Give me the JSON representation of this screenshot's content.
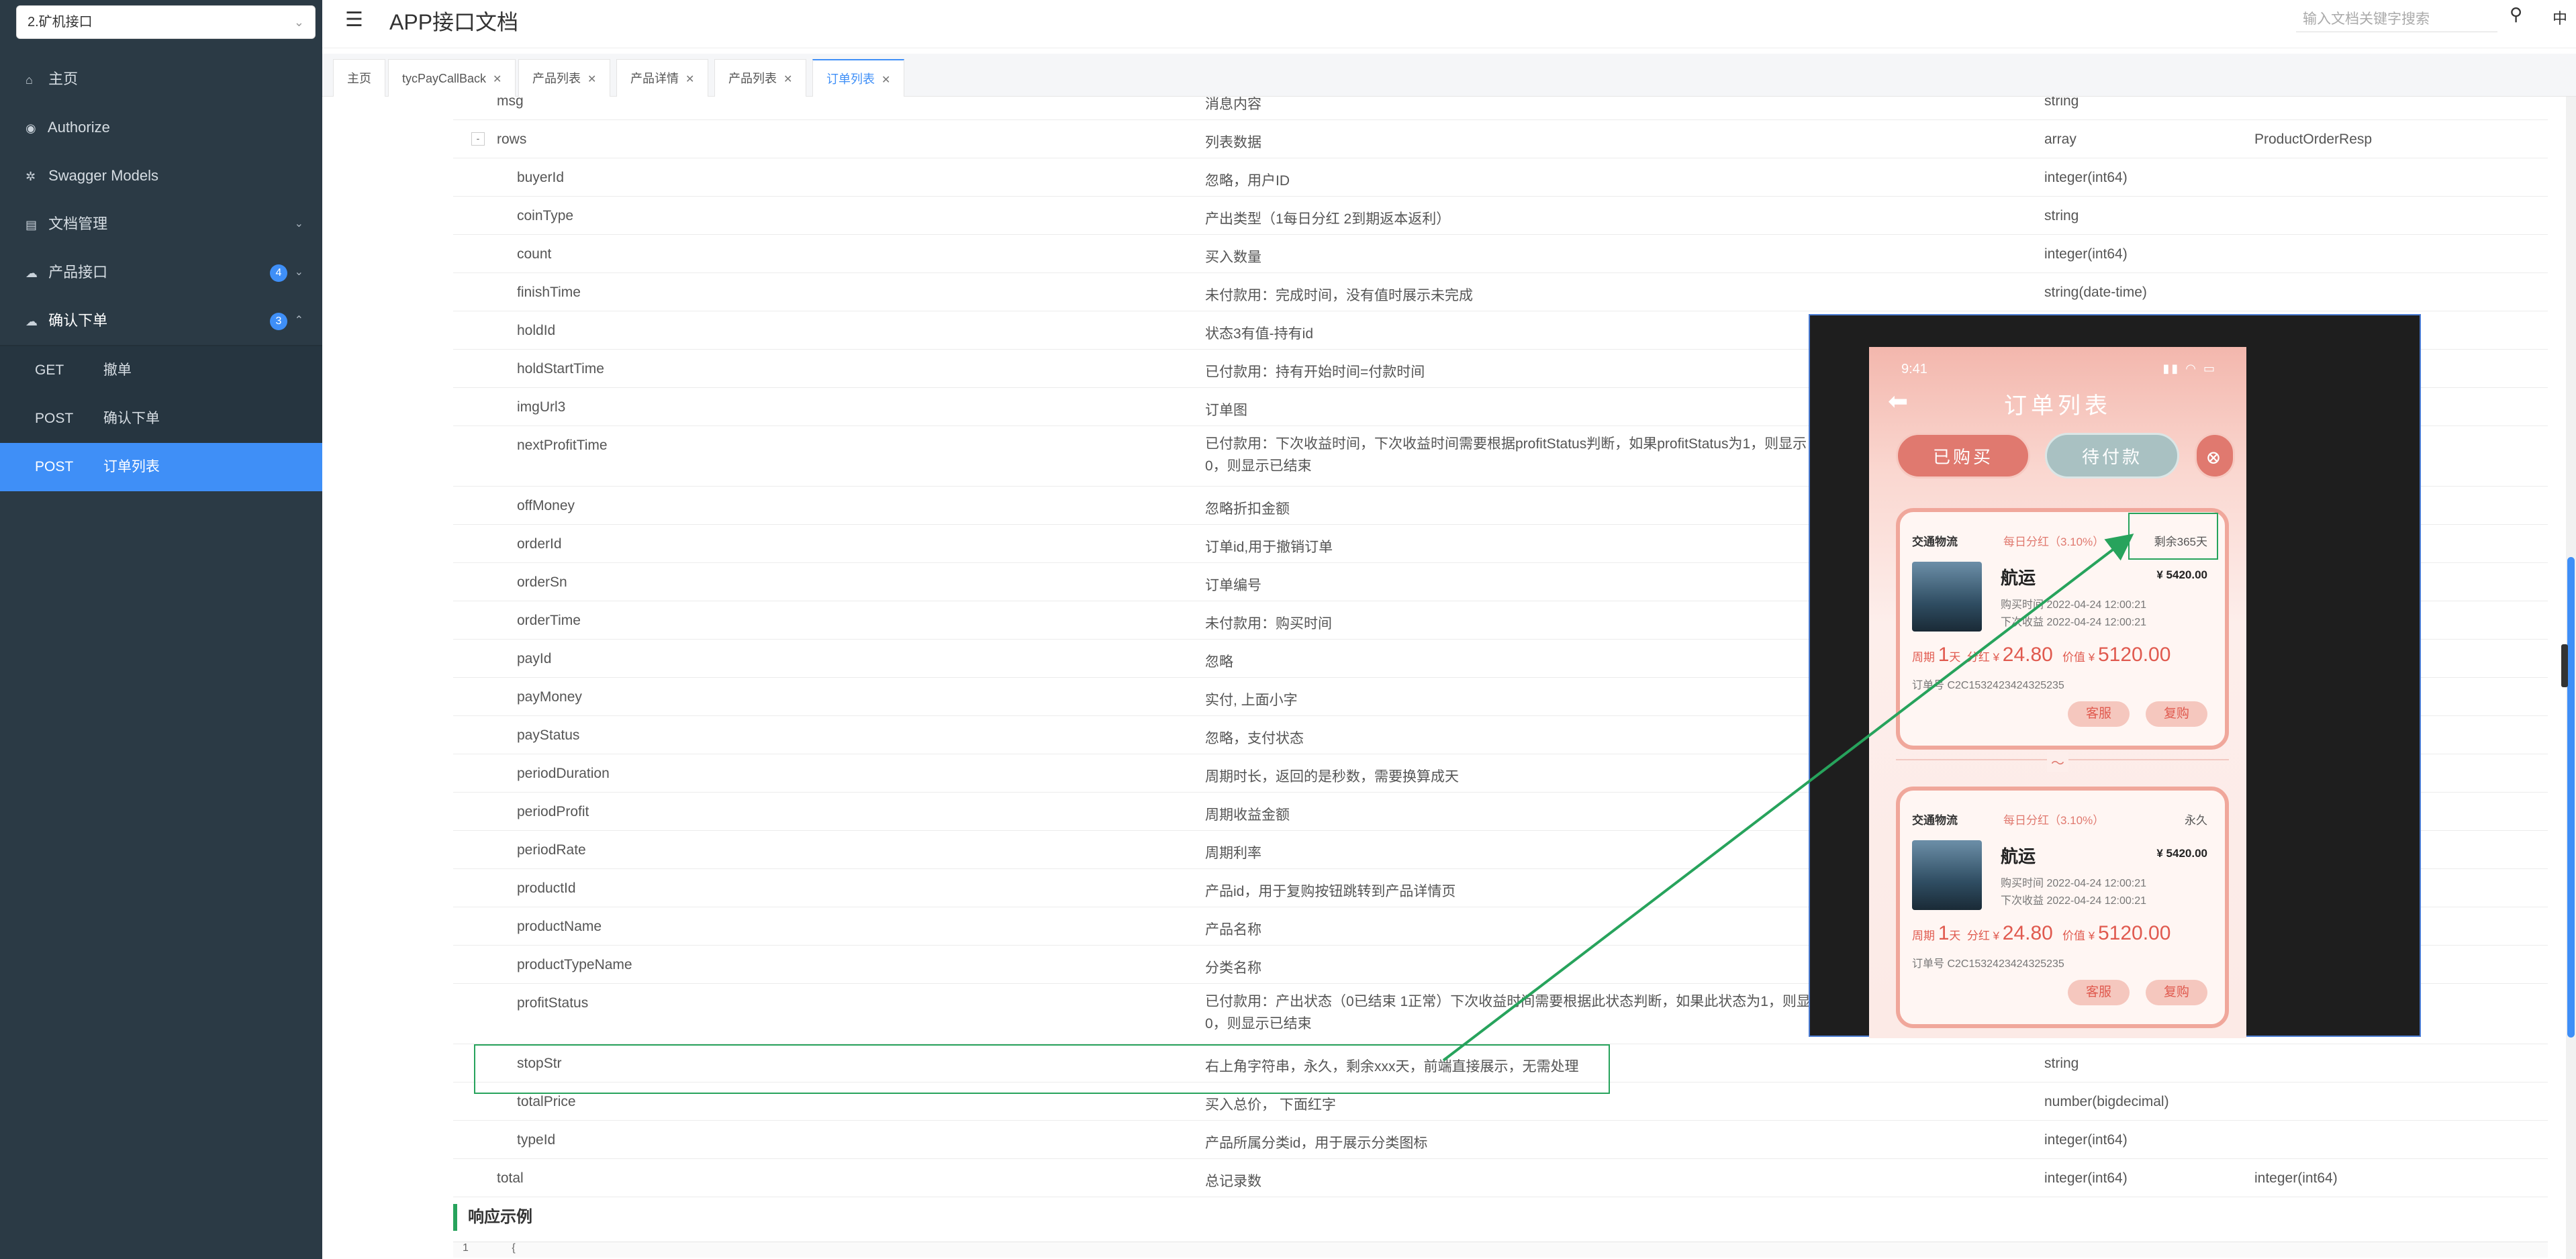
{
  "sidebar": {
    "select_value": "2.矿机接口",
    "items": [
      {
        "label": "主页",
        "icon": "home-icon"
      },
      {
        "label": "Authorize",
        "icon": "lock-icon"
      },
      {
        "label": "Swagger Models",
        "icon": "models-icon"
      },
      {
        "label": "文档管理",
        "icon": "doc-icon"
      },
      {
        "label": "产品接口",
        "icon": "cloud-icon",
        "badge": "4"
      },
      {
        "label": "确认下单",
        "icon": "cloud-icon",
        "badge": "3"
      }
    ],
    "subitems": [
      {
        "method": "GET",
        "label": "撤单"
      },
      {
        "method": "POST",
        "label": "确认下单"
      },
      {
        "method": "POST",
        "label": "订单列表"
      }
    ]
  },
  "header": {
    "title": "APP接口文档",
    "search_placeholder": "输入文档关键字搜索",
    "lang": "中"
  },
  "tabs": [
    {
      "label": "主页",
      "closable": false
    },
    {
      "label": "tycPayCallBack",
      "closable": true
    },
    {
      "label": "产品列表",
      "closable": true
    },
    {
      "label": "产品详情",
      "closable": true
    },
    {
      "label": "产品列表",
      "closable": true
    },
    {
      "label": "订单列表",
      "closable": true,
      "active": true
    }
  ],
  "rows": [
    {
      "name": "msg",
      "desc": "消息内容",
      "type": "string",
      "schema": ""
    },
    {
      "name": "rows",
      "desc": "列表数据",
      "type": "array",
      "schema": "ProductOrderResp"
    },
    {
      "name": "buyerId",
      "desc": "忽略，用户ID",
      "type": "integer(int64)",
      "schema": ""
    },
    {
      "name": "coinType",
      "desc": "产出类型（1每日分红 2到期返本返利）",
      "type": "string",
      "schema": ""
    },
    {
      "name": "count",
      "desc": "买入数量",
      "type": "integer(int64)",
      "schema": ""
    },
    {
      "name": "finishTime",
      "desc": "未付款用：完成时间，没有值时展示未完成",
      "type": "string(date-time)",
      "schema": ""
    },
    {
      "name": "holdId",
      "desc": "状态3有值-持有id",
      "type": "",
      "schema": ""
    },
    {
      "name": "holdStartTime",
      "desc": "已付款用：持有开始时间=付款时间",
      "type": "",
      "schema": ""
    },
    {
      "name": "imgUrl3",
      "desc": "订单图",
      "type": "",
      "schema": ""
    },
    {
      "name": "nextProfitTime",
      "desc": "已付款用：下次收益时间，下次收益时间需要根据profitStatus判断，如果profitStatus为1，则显示",
      "desc2": "0，则显示已结束",
      "type": "",
      "schema": ""
    },
    {
      "name": "offMoney",
      "desc": "忽略折扣金额",
      "type": "",
      "schema": ""
    },
    {
      "name": "orderId",
      "desc": "订单id,用于撤销订单",
      "type": "",
      "schema": ""
    },
    {
      "name": "orderSn",
      "desc": "订单编号",
      "type": "",
      "schema": ""
    },
    {
      "name": "orderTime",
      "desc": "未付款用：购买时间",
      "type": "",
      "schema": ""
    },
    {
      "name": "payId",
      "desc": "忽略",
      "type": "",
      "schema": ""
    },
    {
      "name": "payMoney",
      "desc": "实付, 上面小字",
      "type": "",
      "schema": ""
    },
    {
      "name": "payStatus",
      "desc": "忽略，支付状态",
      "type": "",
      "schema": ""
    },
    {
      "name": "periodDuration",
      "desc": "周期时长，返回的是秒数，需要换算成天",
      "type": "",
      "schema": ""
    },
    {
      "name": "periodProfit",
      "desc": "周期收益金额",
      "type": "",
      "schema": ""
    },
    {
      "name": "periodRate",
      "desc": "周期利率",
      "type": "",
      "schema": ""
    },
    {
      "name": "productId",
      "desc": "产品id，用于复购按钮跳转到产品详情页",
      "type": "",
      "schema": ""
    },
    {
      "name": "productName",
      "desc": "产品名称",
      "type": "",
      "schema": ""
    },
    {
      "name": "productTypeName",
      "desc": "分类名称",
      "type": "",
      "schema": ""
    },
    {
      "name": "profitStatus",
      "desc": "已付款用：产出状态（0已结束 1正常）下次收益时间需要根据此状态判断，如果此状态为1，则显",
      "desc2": "0，则显示已结束",
      "type": "",
      "schema": ""
    },
    {
      "name": "stopStr",
      "desc": "右上角字符串，永久，剩余xxx天，前端直接展示，无需处理",
      "type": "string",
      "schema": ""
    },
    {
      "name": "totalPrice",
      "desc": "买入总价， 下面红字",
      "type": "number(bigdecimal)",
      "schema": ""
    },
    {
      "name": "typeId",
      "desc": "产品所属分类id，用于展示分类图标",
      "type": "integer(int64)",
      "schema": ""
    },
    {
      "name": "total",
      "desc": "总记录数",
      "type": "integer(int64)",
      "schema": "integer(int64)"
    }
  ],
  "response_example": {
    "title": "响应示例",
    "line_no": "1",
    "first_char": "{"
  },
  "phone": {
    "time": "9:41",
    "title": "订单列表",
    "tab_bought": "已购买",
    "tab_pending": "待付款",
    "cards": [
      {
        "category": "交通物流",
        "rate": "每日分红（3.10%）",
        "stop": "剩余365天",
        "name": "航运",
        "price": "¥ 5420.00",
        "buy_time": "购买时间 2022-04-24 12:00:21",
        "next_time": "下次收益 2022-04-24 12:00:21",
        "period_label": "周期",
        "period_value": "1",
        "period_unit": "天",
        "dividend_label": "分红 ¥",
        "dividend_value": "24.80",
        "worth_label": "价值 ¥",
        "worth_value": "5120.00",
        "order_no": "订单号 C2C1532423424325235",
        "btn1": "客服",
        "btn2": "复购"
      },
      {
        "category": "交通物流",
        "rate": "每日分红（3.10%）",
        "stop": "永久",
        "name": "航运",
        "price": "¥ 5420.00",
        "buy_time": "购买时间 2022-04-24 12:00:21",
        "next_time": "下次收益 2022-04-24 12:00:21",
        "period_label": "周期",
        "period_value": "1",
        "period_unit": "天",
        "dividend_label": "分红 ¥",
        "dividend_value": "24.80",
        "worth_label": "价值 ¥",
        "worth_value": "5120.00",
        "order_no": "订单号 C2C1532423424325235",
        "btn1": "客服",
        "btn2": "复购"
      }
    ]
  },
  "colors": {
    "accent": "#3f8ff7",
    "highlight": "#27a35c",
    "sidebar_bg": "#2b3a45"
  }
}
